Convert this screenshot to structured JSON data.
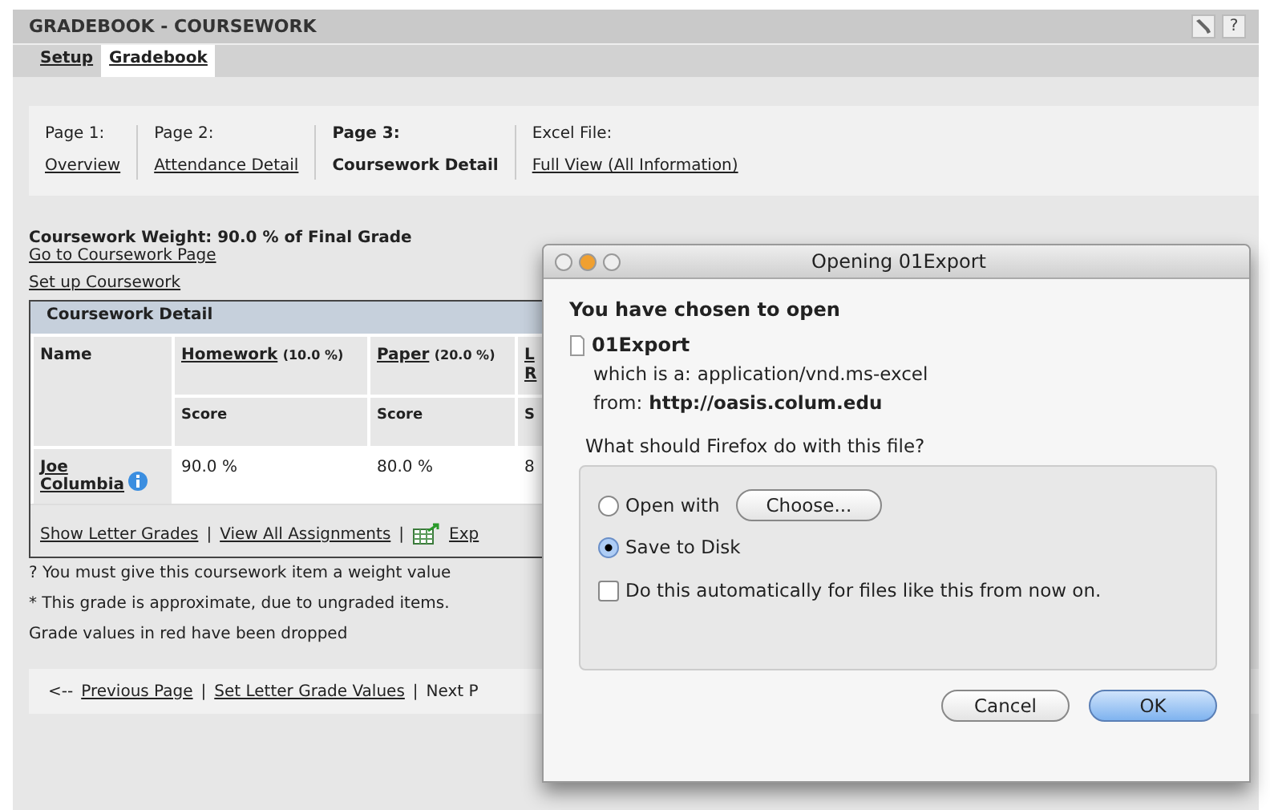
{
  "header": {
    "title": "GRADEBOOK - COURSEWORK",
    "help": "?"
  },
  "tabs": [
    {
      "label": "Setup",
      "selected": false
    },
    {
      "label": "Gradebook",
      "selected": true
    }
  ],
  "page_nav": [
    {
      "heading": "Page 1:",
      "link": "Overview",
      "current": false
    },
    {
      "heading": "Page 2:",
      "link": "Attendance Detail",
      "current": false
    },
    {
      "heading": "Page 3:",
      "link": "Coursework Detail",
      "current": true
    },
    {
      "heading": "Excel File:",
      "link": "Full View (All Information)",
      "current": false
    }
  ],
  "weight_text": "Coursework Weight: 90.0 % of Final Grade",
  "links": [
    "Go to Coursework Page",
    "Set up Coursework"
  ],
  "table": {
    "title": "Coursework Detail",
    "name_header": "Name",
    "columns": [
      {
        "name": "Homework",
        "weight": "(10.0 %)",
        "sub": "Score"
      },
      {
        "name": "Paper",
        "weight": "(20.0 %)",
        "sub": "Score"
      },
      {
        "name": "L R",
        "sub": "S"
      }
    ],
    "rows": [
      {
        "name": "Joe Columbia",
        "info": true,
        "scores": [
          "90.0 %",
          "80.0 %",
          "8"
        ]
      }
    ],
    "footer_links": [
      "Show Letter Grades",
      "View All Assignments"
    ],
    "separator": "|",
    "export": "Exp"
  },
  "notes": [
    "? You must give this coursework item a weight value",
    "* This grade is approximate, due to ungraded items.",
    "Grade values in red have been dropped"
  ],
  "bottom_nav": {
    "prefix": "<--",
    "links": [
      "Previous Page",
      "Set Letter Grade Values"
    ],
    "separator": "|",
    "tail": "Next P"
  },
  "dialog": {
    "title": "Opening 01Export",
    "heading": "You have chosen to open",
    "file": "01Export",
    "type_label": "which is a:",
    "type": "application/vnd.ms-excel",
    "from_label": "from:",
    "from": "http://oasis.colum.edu",
    "question": "What should Firefox do with this file?",
    "options": [
      {
        "kind": "radio",
        "label": "Open with",
        "selected": false,
        "button": "Choose..."
      },
      {
        "kind": "radio",
        "label": "Save to Disk",
        "selected": true
      },
      {
        "kind": "checkbox",
        "label": "Do this automatically for files like this from now on.",
        "checked": false
      }
    ],
    "buttons": [
      {
        "label": "Cancel",
        "default": false
      },
      {
        "label": "OK",
        "default": true
      }
    ]
  }
}
